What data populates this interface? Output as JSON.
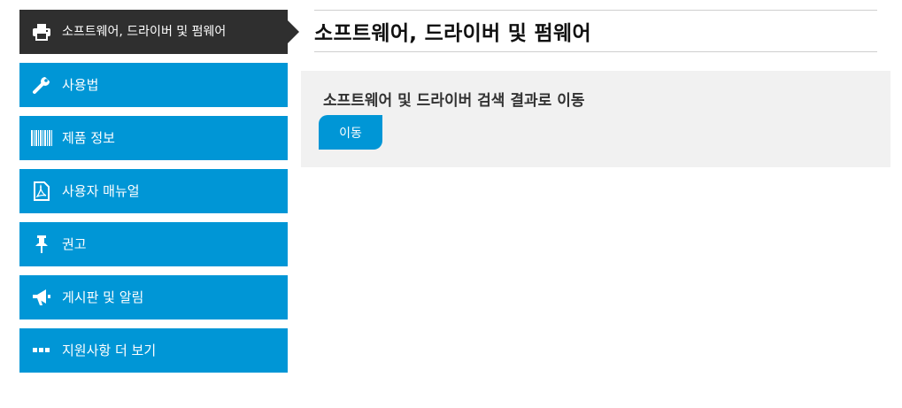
{
  "sidebar": {
    "items": [
      {
        "label": "소프트웨어, 드라이버 및 펌웨어",
        "icon": "printer-icon",
        "active": true
      },
      {
        "label": "사용법",
        "icon": "wrench-icon"
      },
      {
        "label": "제품 정보",
        "icon": "barcode-icon"
      },
      {
        "label": "사용자 매뉴얼",
        "icon": "pdf-icon"
      },
      {
        "label": "권고",
        "icon": "pushpin-icon"
      },
      {
        "label": "게시판 및 알림",
        "icon": "megaphone-icon"
      },
      {
        "label": "지원사항 더 보기",
        "icon": "more-icon"
      }
    ]
  },
  "main": {
    "title": "소프트웨어, 드라이버 및 펌웨어",
    "panel": {
      "text": "소프트웨어 및 드라이버 검색 결과로 이동",
      "button_label": "이동"
    }
  },
  "colors": {
    "accent": "#0096d6",
    "active": "#2f2f2f",
    "panel_bg": "#f1f1f1"
  }
}
